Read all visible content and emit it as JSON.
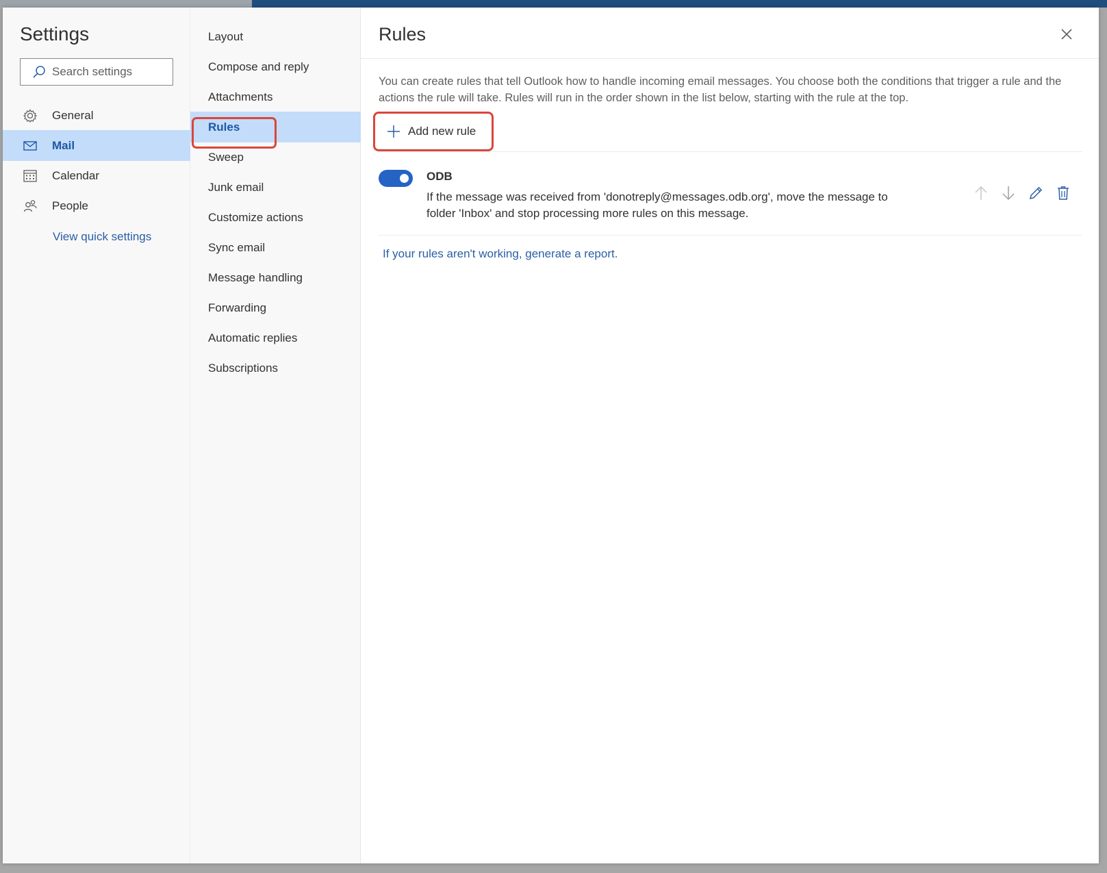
{
  "settings": {
    "title": "Settings",
    "search": {
      "placeholder": "Search settings"
    },
    "categories": [
      {
        "label": "General",
        "icon": "gear-icon"
      },
      {
        "label": "Mail",
        "icon": "mail-icon",
        "selected": true
      },
      {
        "label": "Calendar",
        "icon": "calendar-icon"
      },
      {
        "label": "People",
        "icon": "people-icon"
      }
    ],
    "quick_settings_link": "View quick settings"
  },
  "mail_menu": {
    "items": [
      {
        "label": "Layout"
      },
      {
        "label": "Compose and reply"
      },
      {
        "label": "Attachments"
      },
      {
        "label": "Rules",
        "selected": true
      },
      {
        "label": "Sweep"
      },
      {
        "label": "Junk email"
      },
      {
        "label": "Customize actions"
      },
      {
        "label": "Sync email"
      },
      {
        "label": "Message handling"
      },
      {
        "label": "Forwarding"
      },
      {
        "label": "Automatic replies"
      },
      {
        "label": "Subscriptions"
      }
    ]
  },
  "rules_panel": {
    "title": "Rules",
    "description": "You can create rules that tell Outlook how to handle incoming email messages. You choose both the conditions that trigger a rule and the actions the rule will take. Rules will run in the order shown in the list below, starting with the rule at the top.",
    "add_rule_label": "Add new rule",
    "rules": [
      {
        "name": "ODB",
        "enabled": true,
        "description": "If the message was received from 'donotreply@messages.odb.org', move the message to folder 'Inbox' and stop processing more rules on this message."
      }
    ],
    "report_link": "If your rules aren't working, generate a report."
  },
  "colors": {
    "accent": "#2563c5",
    "selected_bg": "#c2dcfa",
    "link": "#2b5ea7",
    "annotation": "#d9463a"
  }
}
